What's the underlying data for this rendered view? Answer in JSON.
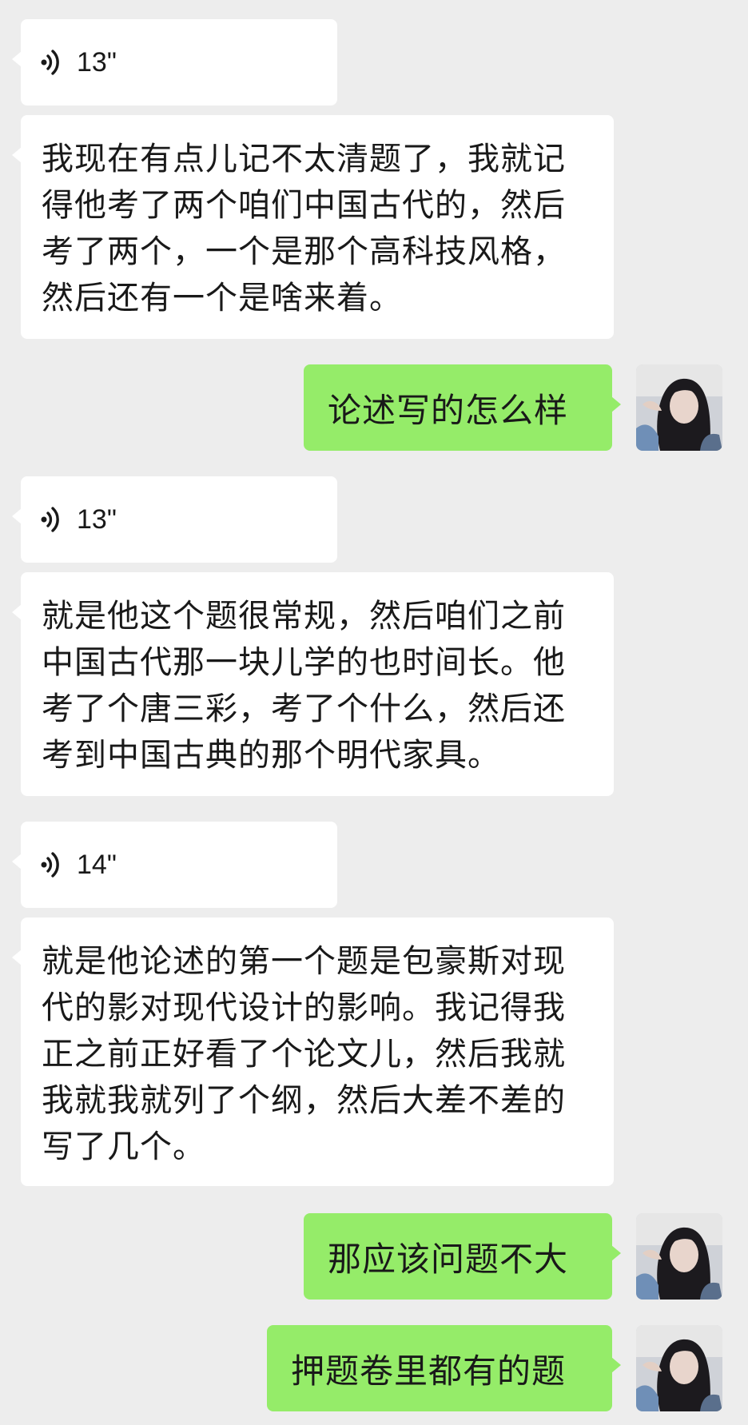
{
  "messages": [
    {
      "type": "voice",
      "side": "left",
      "duration": "13\""
    },
    {
      "type": "text",
      "side": "left",
      "text": "我现在有点儿记不太清题了，我就记得他考了两个咱们中国古代的，然后考了两个，一个是那个高科技风格，然后还有一个是啥来着。"
    },
    {
      "type": "text",
      "side": "right",
      "text": "论述写的怎么样"
    },
    {
      "type": "voice",
      "side": "left",
      "duration": "13\""
    },
    {
      "type": "text",
      "side": "left",
      "text": "就是他这个题很常规，然后咱们之前中国古代那一块儿学的也时间长。他考了个唐三彩，考了个什么，然后还考到中国古典的那个明代家具。"
    },
    {
      "type": "voice",
      "side": "left",
      "duration": "14\""
    },
    {
      "type": "text",
      "side": "left",
      "text": "就是他论述的第一个题是包豪斯对现代的影对现代设计的影响。我记得我正之前正好看了个论文儿，然后我就我就我就列了个纲，然后大差不差的写了几个。"
    },
    {
      "type": "text",
      "side": "right",
      "text": "那应该问题不大"
    },
    {
      "type": "text",
      "side": "right",
      "text": "押题卷里都有的题"
    }
  ],
  "icons": {
    "voice": "voice-wave-icon",
    "avatar": "user-avatar"
  },
  "colors": {
    "background": "#ededed",
    "left_bubble": "#ffffff",
    "right_bubble": "#95ec69",
    "text": "#191919"
  }
}
